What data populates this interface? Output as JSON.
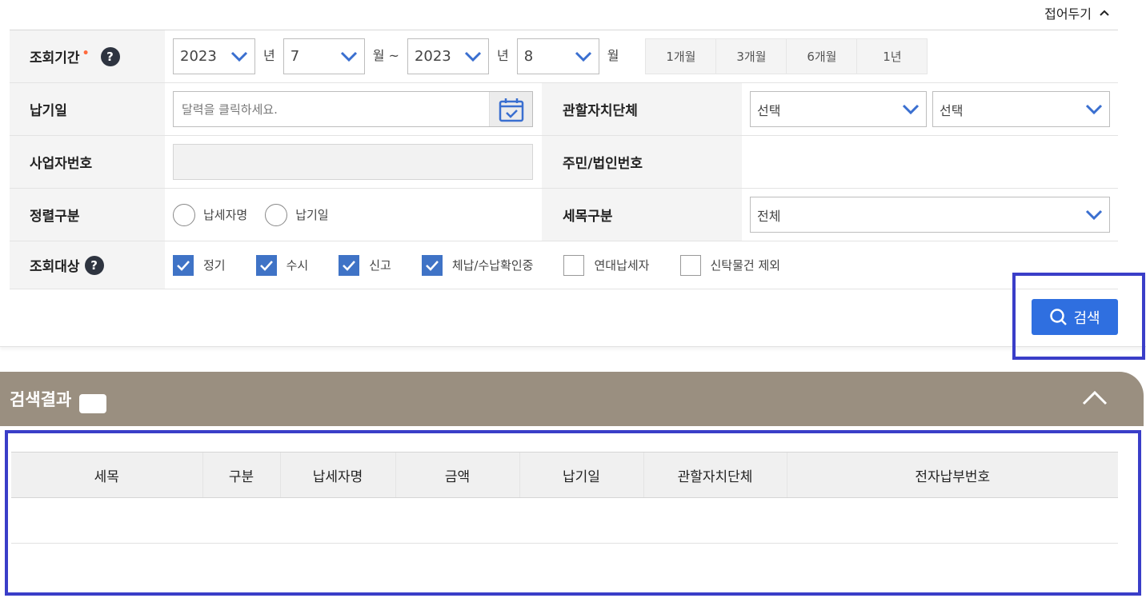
{
  "fold_toggle": {
    "label": "접어두기"
  },
  "form": {
    "period": {
      "label": "조회기간",
      "required_mark": "•",
      "help": "?",
      "start_year": "2023",
      "year_unit": "년",
      "start_month": "7",
      "month_unit_range": "월 ~",
      "end_year": "2023",
      "end_month": "8",
      "month_unit": "월",
      "quick_buttons": [
        "1개월",
        "3개월",
        "6개월",
        "1년"
      ]
    },
    "due_date": {
      "label": "납기일",
      "placeholder": "달력을 클릭하세요."
    },
    "jurisdiction": {
      "label": "관할자치단체",
      "select1": "선택",
      "select2": "선택"
    },
    "business_no": {
      "label": "사업자번호"
    },
    "resident_no": {
      "label": "주민/법인번호"
    },
    "sort": {
      "label": "정렬구분",
      "options": [
        "납세자명",
        "납기일"
      ]
    },
    "tax_item": {
      "label": "세목구분",
      "value": "전체"
    },
    "target": {
      "label": "조회대상",
      "help": "?",
      "options": [
        {
          "label": "정기",
          "checked": true
        },
        {
          "label": "수시",
          "checked": true
        },
        {
          "label": "신고",
          "checked": true
        },
        {
          "label": "체납/수납확인중",
          "checked": true
        },
        {
          "label": "연대납세자",
          "checked": false
        },
        {
          "label": "신탁물건 제외",
          "checked": false
        }
      ]
    }
  },
  "search_button": {
    "label": "검색"
  },
  "results": {
    "title": "검색결과",
    "columns": [
      "세목",
      "구분",
      "납세자명",
      "금액",
      "납기일",
      "관할자치단체",
      "전자납부번호"
    ]
  },
  "colors": {
    "primary": "#2f6fe0",
    "checkbox": "#3f73c6",
    "result_header": "#9a8f80",
    "highlight": "#3a3ec8",
    "required": "#ff6a3d"
  }
}
